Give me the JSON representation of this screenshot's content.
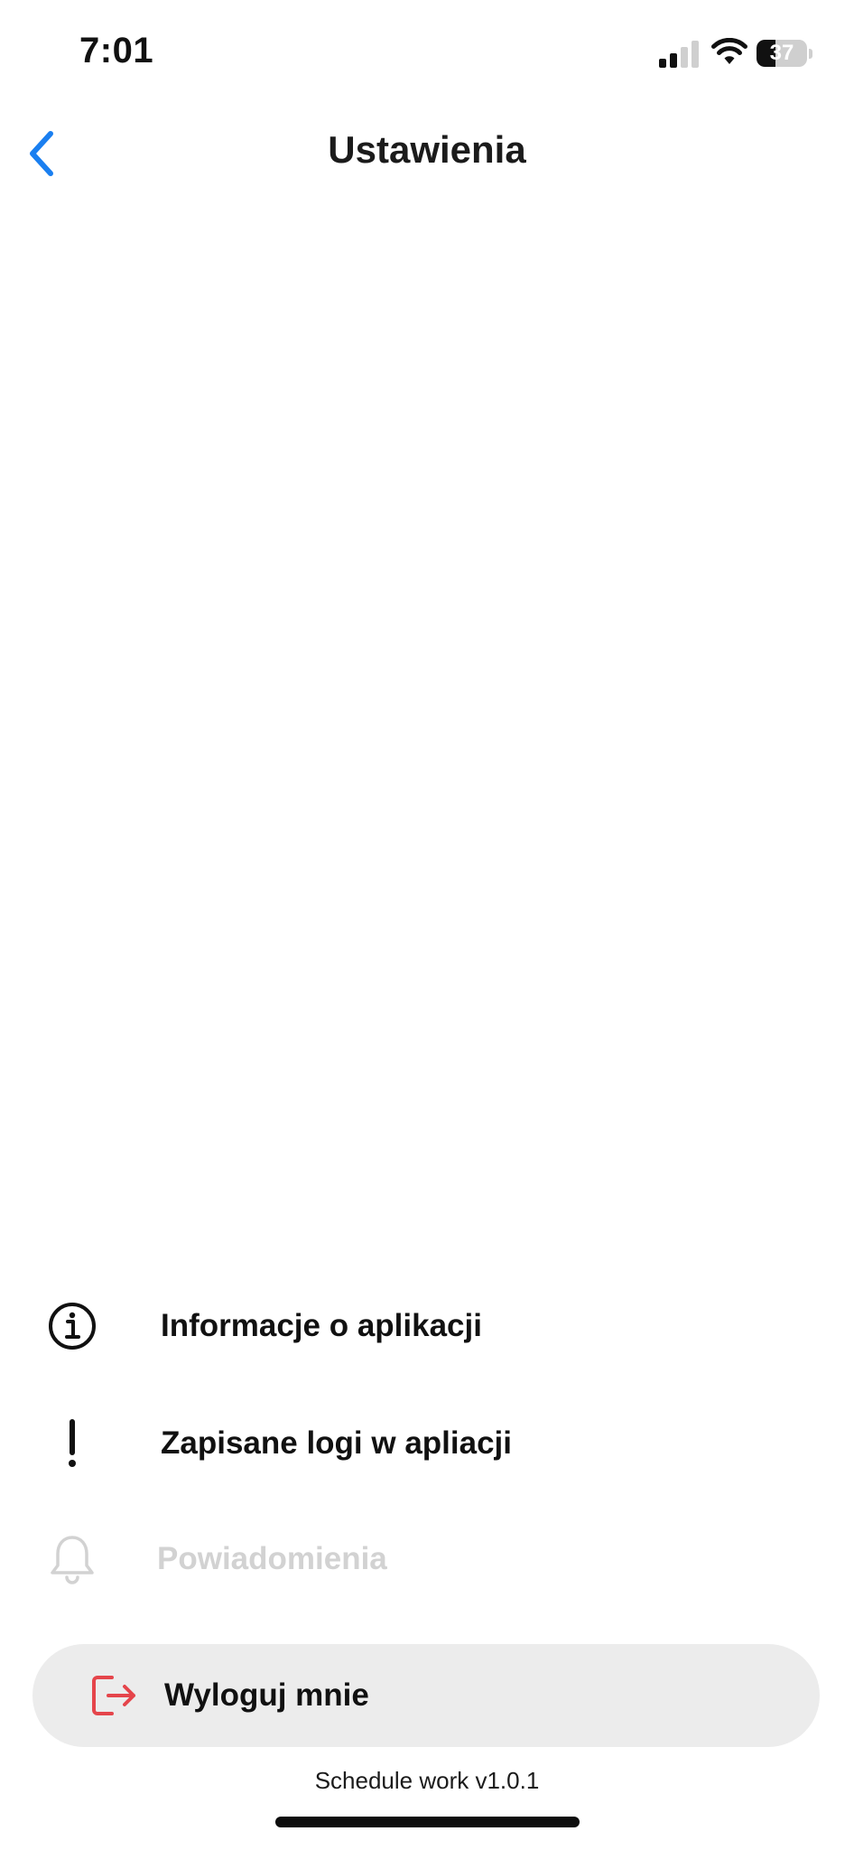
{
  "status_bar": {
    "time": "7:01",
    "battery_level": "37",
    "battery_fraction": 0.37,
    "icons": [
      "signal-icon",
      "wifi-icon",
      "battery-icon"
    ]
  },
  "header": {
    "title": "Ustawienia",
    "back_icon": "chevron-left-icon"
  },
  "menu": {
    "items": [
      {
        "label": "Informacje o aplikacji",
        "icon": "info-circle-icon",
        "enabled": true
      },
      {
        "label": "Zapisane logi w apliacji",
        "icon": "exclamation-icon",
        "enabled": true
      },
      {
        "label": "Powiadomienia",
        "icon": "bell-icon",
        "enabled": false
      }
    ]
  },
  "logout": {
    "label": "Wyloguj mnie",
    "icon": "logout-icon"
  },
  "footer": {
    "version": "Schedule work v1.0.1"
  },
  "colors": {
    "accent": "#1a7ff0",
    "logout_icon": "#e5454b",
    "disabled_text": "#d2d2d2",
    "button_bg": "#ececec"
  }
}
